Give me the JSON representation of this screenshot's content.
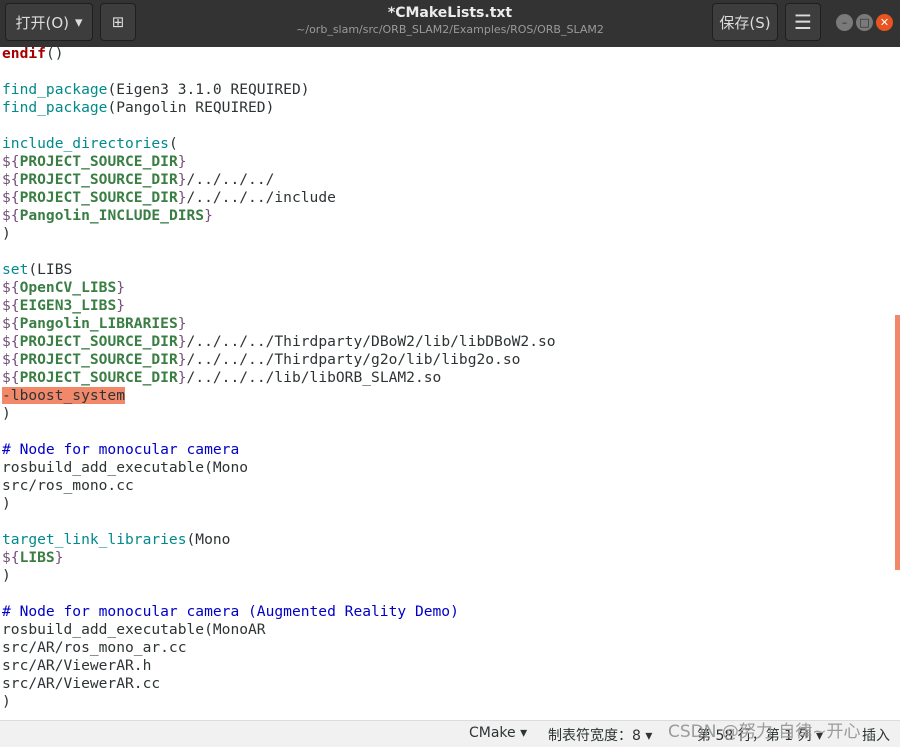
{
  "titlebar": {
    "open_label": "打开(O)",
    "open_arrow": "▾",
    "new_tab_icon": "⊞",
    "title": "*CMakeLists.txt",
    "path": "~/orb_slam/src/ORB_SLAM2/Examples/ROS/ORB_SLAM2",
    "save_label": "保存(S)",
    "menu_icon": "☰",
    "minimize_icon": "–",
    "maximize_icon": "□",
    "close_icon": "✕"
  },
  "code": {
    "lines": [
      [
        {
          "t": "endif",
          "c": "kw"
        },
        {
          "t": "()"
        }
      ],
      [],
      [
        {
          "t": "find_package",
          "c": "fn"
        },
        {
          "t": "(Eigen3 3.1.0 REQUIRED)"
        }
      ],
      [
        {
          "t": "find_package",
          "c": "fn"
        },
        {
          "t": "(Pangolin REQUIRED)"
        }
      ],
      [],
      [
        {
          "t": "include_directories",
          "c": "fn"
        },
        {
          "t": "("
        }
      ],
      [
        {
          "t": "${",
          "c": "pct"
        },
        {
          "t": "PROJECT_SOURCE_DIR",
          "c": "var"
        },
        {
          "t": "}",
          "c": "pct"
        }
      ],
      [
        {
          "t": "${",
          "c": "pct"
        },
        {
          "t": "PROJECT_SOURCE_DIR",
          "c": "var"
        },
        {
          "t": "}",
          "c": "pct"
        },
        {
          "t": "/../../../"
        }
      ],
      [
        {
          "t": "${",
          "c": "pct"
        },
        {
          "t": "PROJECT_SOURCE_DIR",
          "c": "var"
        },
        {
          "t": "}",
          "c": "pct"
        },
        {
          "t": "/../../../include"
        }
      ],
      [
        {
          "t": "${",
          "c": "pct"
        },
        {
          "t": "Pangolin_INCLUDE_DIRS",
          "c": "var"
        },
        {
          "t": "}",
          "c": "pct"
        }
      ],
      [
        {
          "t": ")"
        }
      ],
      [],
      [
        {
          "t": "set",
          "c": "fn"
        },
        {
          "t": "(LIBS"
        }
      ],
      [
        {
          "t": "${",
          "c": "pct"
        },
        {
          "t": "OpenCV_LIBS",
          "c": "var"
        },
        {
          "t": "}",
          "c": "pct"
        }
      ],
      [
        {
          "t": "${",
          "c": "pct"
        },
        {
          "t": "EIGEN3_LIBS",
          "c": "var"
        },
        {
          "t": "}",
          "c": "pct"
        }
      ],
      [
        {
          "t": "${",
          "c": "pct"
        },
        {
          "t": "Pangolin_LIBRARIES",
          "c": "var"
        },
        {
          "t": "}",
          "c": "pct"
        }
      ],
      [
        {
          "t": "${",
          "c": "pct"
        },
        {
          "t": "PROJECT_SOURCE_DIR",
          "c": "var"
        },
        {
          "t": "}",
          "c": "pct"
        },
        {
          "t": "/../../../Thirdparty/DBoW2/lib/libDBoW2.so"
        }
      ],
      [
        {
          "t": "${",
          "c": "pct"
        },
        {
          "t": "PROJECT_SOURCE_DIR",
          "c": "var"
        },
        {
          "t": "}",
          "c": "pct"
        },
        {
          "t": "/../../../Thirdparty/g2o/lib/libg2o.so"
        }
      ],
      [
        {
          "t": "${",
          "c": "pct"
        },
        {
          "t": "PROJECT_SOURCE_DIR",
          "c": "var"
        },
        {
          "t": "}",
          "c": "pct"
        },
        {
          "t": "/../../../lib/libORB_SLAM2.so"
        }
      ],
      [
        {
          "t": "-lboost_system",
          "c": "sel"
        }
      ],
      [
        {
          "t": ")"
        }
      ],
      [],
      [
        {
          "t": "# Node for monocular camera",
          "c": "cmt"
        }
      ],
      [
        {
          "t": "rosbuild_add_executable(Mono"
        }
      ],
      [
        {
          "t": "src/ros_mono.cc"
        }
      ],
      [
        {
          "t": ")"
        }
      ],
      [],
      [
        {
          "t": "target_link_libraries",
          "c": "fn"
        },
        {
          "t": "(Mono"
        }
      ],
      [
        {
          "t": "${",
          "c": "pct"
        },
        {
          "t": "LIBS",
          "c": "var"
        },
        {
          "t": "}",
          "c": "pct"
        }
      ],
      [
        {
          "t": ")"
        }
      ],
      [],
      [
        {
          "t": "# Node for monocular camera (Augmented Reality Demo)",
          "c": "cmt"
        }
      ],
      [
        {
          "t": "rosbuild_add_executable(MonoAR"
        }
      ],
      [
        {
          "t": "src/AR/ros_mono_ar.cc"
        }
      ],
      [
        {
          "t": "src/AR/ViewerAR.h"
        }
      ],
      [
        {
          "t": "src/AR/ViewerAR.cc"
        }
      ],
      [
        {
          "t": ")"
        }
      ],
      []
    ]
  },
  "statusbar": {
    "language": "CMake ▾",
    "tab_width": "制表符宽度：8 ▾",
    "position": "第 58 行，第 1 列 ▾",
    "insert_mode": "插入"
  },
  "watermark": "CSDN @努力 自律~开心",
  "colors": {
    "titlebar_bg": "#333333",
    "selection": "#f2886a",
    "close_button": "#e95420"
  }
}
